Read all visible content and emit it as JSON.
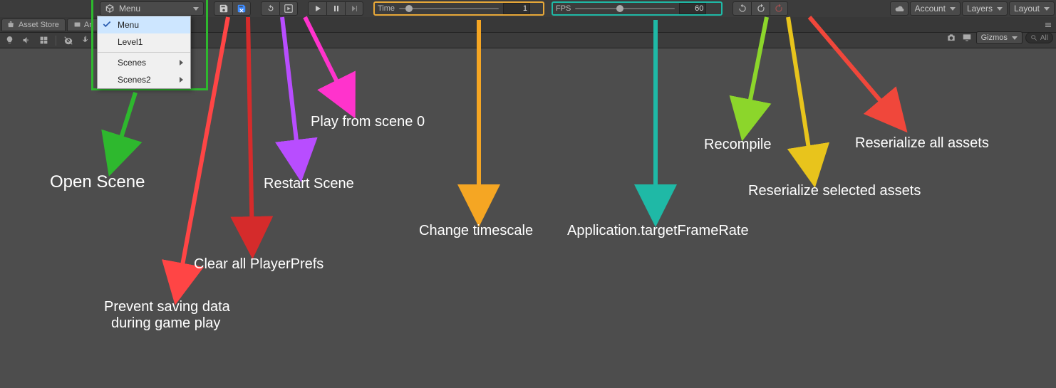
{
  "toolbar": {
    "menuLabel": "Menu",
    "dropdown": {
      "items": [
        {
          "label": "Menu",
          "selected": true
        },
        {
          "label": "Level1"
        },
        {
          "sep": true
        },
        {
          "label": "Scenes",
          "submenu": true
        },
        {
          "label": "Scenes2",
          "submenu": true
        }
      ]
    },
    "timeSlider": {
      "label": "Time",
      "value": "1",
      "pos": 10
    },
    "fpsSlider": {
      "label": "FPS",
      "value": "60",
      "pos": 45
    }
  },
  "rightDropdowns": {
    "account": "Account",
    "layers": "Layers",
    "layout": "Layout"
  },
  "secondary": {
    "gizmos": "Gizmos",
    "searchPlaceholder": "All"
  },
  "tabs": {
    "assetStore": "Asset Store",
    "animator": "An"
  },
  "annotations": {
    "openScene": "Open Scene",
    "preventSaving1": "Prevent saving data",
    "preventSaving2": "during game play",
    "clearPrefs": "Clear all PlayerPrefs",
    "restartScene": "Restart Scene",
    "playScene0": "Play from scene 0",
    "timescale": "Change timescale",
    "fpsNote": "Application.targetFrameRate",
    "recompile": "Recompile",
    "reserializeSel": "Reserialize selected assets",
    "reserializeAll": "Reserialize all assets"
  },
  "colors": {
    "green": "#2eb82e",
    "red": "#ff4545",
    "darkred": "#d52b2b",
    "purple": "#b84dff",
    "magenta": "#ff33cc",
    "orange": "#f5a623",
    "teal": "#1fb9a6",
    "lime": "#8cd62b",
    "yellow": "#e8c41c",
    "red2": "#f0473b"
  }
}
